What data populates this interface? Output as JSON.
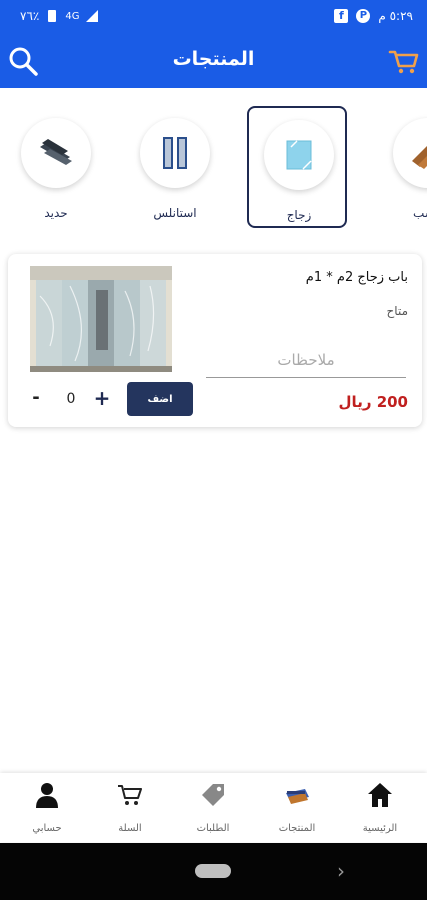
{
  "status_bar": {
    "time": "٥:٢٩ م",
    "battery": "٧٦٪",
    "network": "4G"
  },
  "header": {
    "title": "المنتجات"
  },
  "categories": [
    {
      "label": "خشب",
      "icon": "wood-icon",
      "selected": false
    },
    {
      "label": "زجاج",
      "icon": "glass-icon",
      "selected": true
    },
    {
      "label": "استانلس",
      "icon": "stainless-icon",
      "selected": false
    },
    {
      "label": "حديد",
      "icon": "iron-icon",
      "selected": false
    }
  ],
  "product": {
    "name": "باب زجاج 2م * 1م",
    "status": "متاح",
    "notes_placeholder": "ملاحظات",
    "price": "200 ريال",
    "add_label": "اضف",
    "qty_minus": "-",
    "qty_value": "0",
    "qty_plus": "+"
  },
  "bottom_nav": [
    {
      "label": "الرئيسية",
      "icon": "home-icon"
    },
    {
      "label": "المنتجات",
      "icon": "products-icon"
    },
    {
      "label": "الطلبات",
      "icon": "tag-icon"
    },
    {
      "label": "السلة",
      "icon": "cart-icon"
    },
    {
      "label": "حسابي",
      "icon": "user-icon"
    }
  ],
  "colors": {
    "primary": "#1a5ce6",
    "dark_navy": "#1f2a52",
    "price_red": "#c0201f",
    "cart_orange": "#f0a04b"
  }
}
